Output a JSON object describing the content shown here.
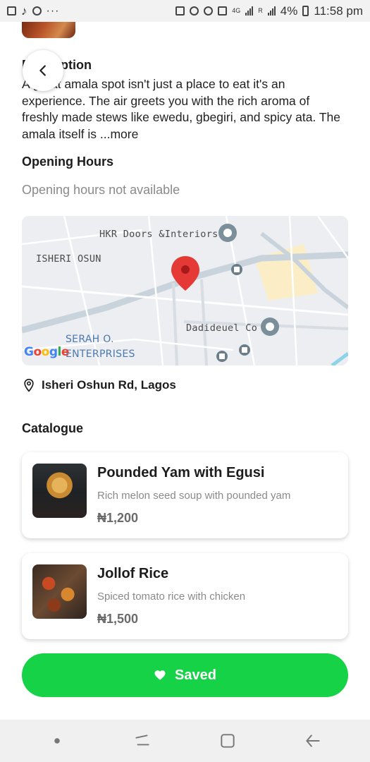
{
  "status_bar": {
    "left_icons": [
      "gallery-icon",
      "tiktok-icon",
      "whatsapp-icon"
    ],
    "more": "···",
    "network": "4G",
    "signal_small": "R",
    "battery": "4%",
    "time": "11:58 pm"
  },
  "description": {
    "title": "Description",
    "text": "A great amala spot isn't just a place to eat it's an experience. The air greets you with the rich aroma of freshly made stews like ewedu, gbegiri, and spicy ata. The amala itself is ",
    "more_label": "...more"
  },
  "opening_hours": {
    "title": "Opening Hours",
    "text": "Opening hours not available"
  },
  "map": {
    "labels": {
      "hkr": "HKR Doors &Interiors",
      "isheri": "ISHERI OSUN",
      "dadi": "Dadideuel Co",
      "serah1": "SERAH O.",
      "serah2": "ENTERPRISES"
    },
    "google_logo": [
      "G",
      "o",
      "o",
      "g",
      "l",
      "e"
    ],
    "colors": {
      "pin": "#e53935",
      "poi": "#7a8f9a",
      "road": "#ffffff",
      "major_road": "#c9d3dc",
      "park": "#fbeec7"
    }
  },
  "address": "Isheri Oshun Rd, Lagos",
  "catalogue": {
    "title": "Catalogue",
    "items": [
      {
        "name": "Pounded Yam with Egusi",
        "description": "Rich melon seed soup with pounded yam",
        "price": "₦1,200",
        "image": "pounded-yam-image"
      },
      {
        "name": "Jollof Rice",
        "description": "Spiced tomato rice with chicken",
        "price": "₦1,500",
        "image": "jollof-rice-image"
      }
    ]
  },
  "saved_button": {
    "label": "Saved",
    "color": "#16d246"
  }
}
